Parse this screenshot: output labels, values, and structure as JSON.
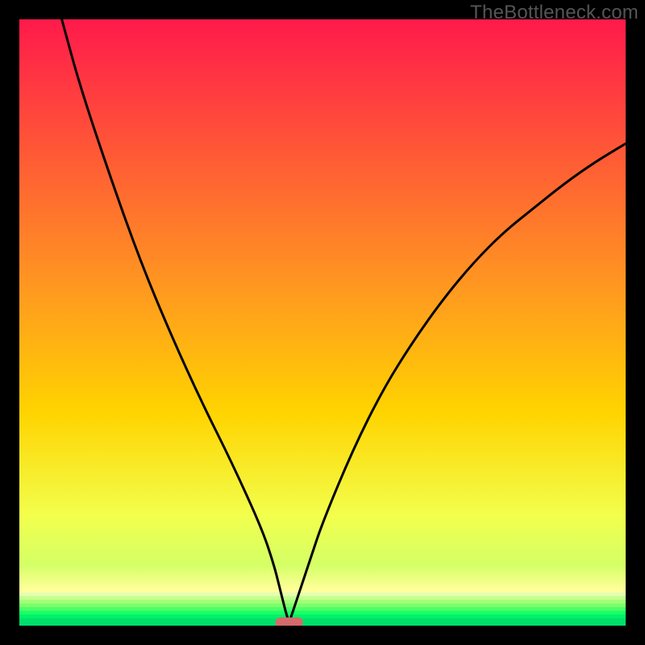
{
  "watermark": "TheBottleneck.com",
  "chart_data": {
    "type": "line",
    "title": "",
    "xlabel": "",
    "ylabel": "",
    "xlim": [
      0,
      100
    ],
    "ylim": [
      0,
      100
    ],
    "grid": false,
    "legend": false,
    "annotations": [],
    "background_gradient": {
      "top_color": "#ff1a4b",
      "mid_color": "#ffd400",
      "bottom_color": "#00e06a"
    },
    "marker": {
      "x": 44.5,
      "y": 0.5,
      "shape": "rounded-rect",
      "color": "#d46a6a"
    },
    "series": [
      {
        "name": "curve",
        "x": [
          7.0,
          10,
          15,
          20,
          25,
          30,
          35,
          40,
          42,
          43,
          44,
          44.5,
          45,
          46,
          48,
          50,
          55,
          60,
          65,
          70,
          75,
          80,
          85,
          90,
          95,
          100
        ],
        "values": [
          100,
          89,
          74,
          60,
          48,
          37,
          27,
          16,
          10,
          6,
          2,
          0.5,
          2,
          5,
          11,
          17,
          29,
          39,
          47,
          54,
          60,
          65,
          69,
          73,
          76.5,
          79.5
        ]
      }
    ]
  }
}
